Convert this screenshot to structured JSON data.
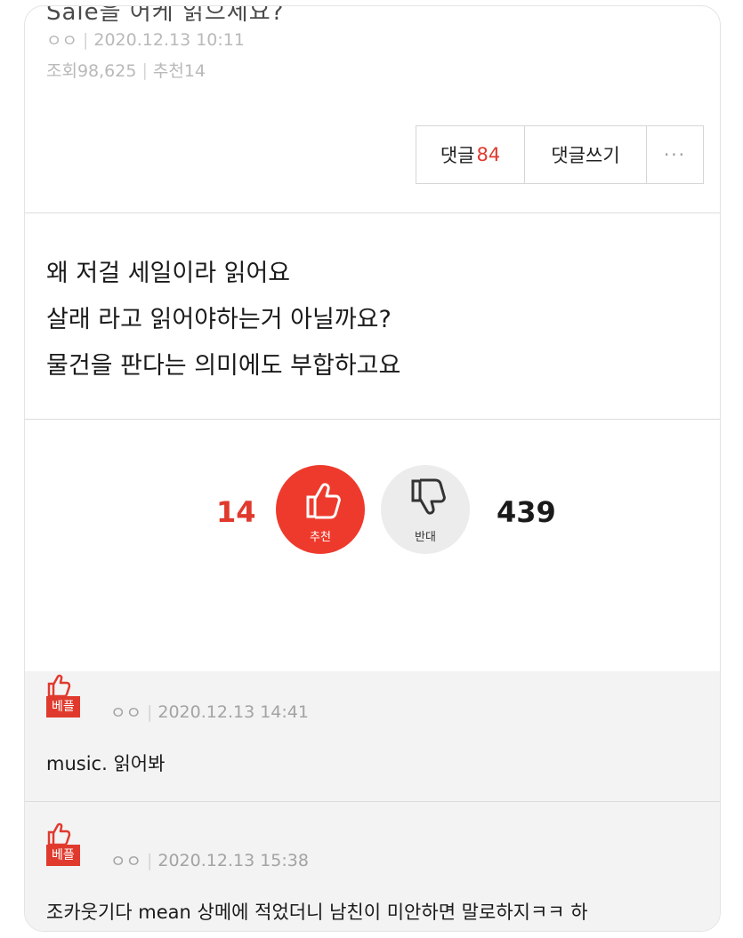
{
  "post": {
    "title_fragment": "Sale을 어케 읽으세요?",
    "author": "ㅇㅇ",
    "date": "2020.12.13 10:11",
    "views": "조회98,625",
    "recommend": "추천14",
    "content_lines": [
      "왜 저걸 세일이라 읽어요",
      "살래 라고 읽어야하는거 아닐까요?",
      "물건을 판다는 의미에도 부합하고요"
    ]
  },
  "toolbar": {
    "comments_label": "댓글",
    "comments_count": "84",
    "write_label": "댓글쓰기",
    "more_label": "···"
  },
  "vote": {
    "up_count": "14",
    "up_label": "추천",
    "down_label": "반대",
    "down_count": "439"
  },
  "comments": [
    {
      "badge": "베플",
      "author": "ㅇㅇ",
      "date": "2020.12.13 14:41",
      "text": "music. 읽어봐"
    },
    {
      "badge": "베플",
      "author": "ㅇㅇ",
      "date": "2020.12.13 15:38",
      "text": "조카웃기다 mean 상메에 적었더니 남친이 미안하면 말로하지ㅋㅋ 하"
    }
  ],
  "colors": {
    "accent": "#e03a2e",
    "divider": "#dcdcdc",
    "comment_bg": "#f3f3f3"
  }
}
